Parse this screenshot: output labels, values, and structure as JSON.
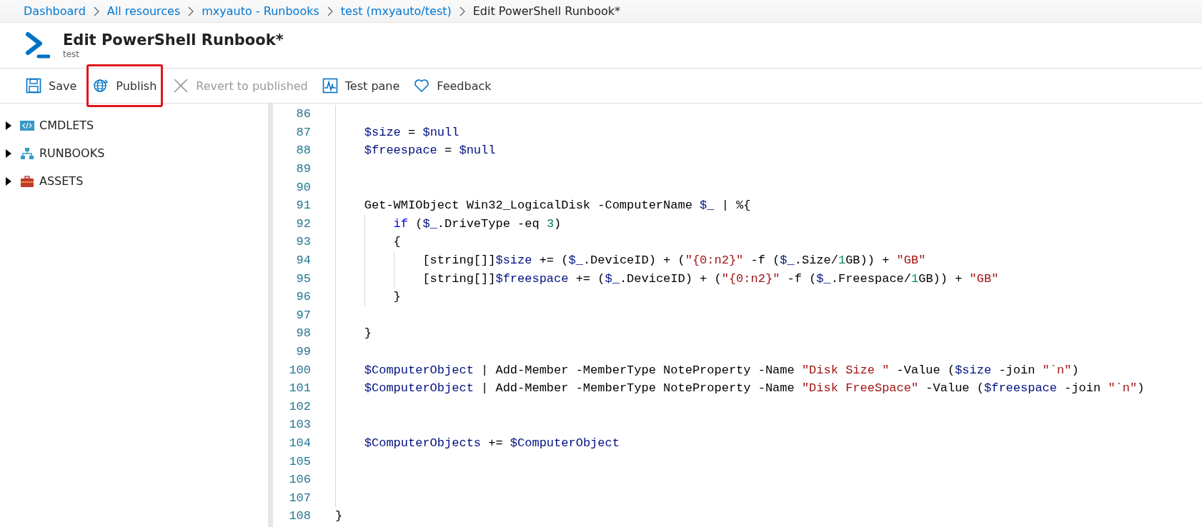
{
  "breadcrumb": [
    {
      "label": "Dashboard",
      "current": false
    },
    {
      "label": "All resources",
      "current": false
    },
    {
      "label": "mxyauto - Runbooks",
      "current": false
    },
    {
      "label": "test (mxyauto/test)",
      "current": false
    },
    {
      "label": "Edit PowerShell Runbook*",
      "current": true
    }
  ],
  "header": {
    "title": "Edit PowerShell Runbook*",
    "subtitle": "test"
  },
  "toolbar": [
    {
      "kind": "save",
      "label": "Save",
      "disabled": false,
      "highlighted": false
    },
    {
      "kind": "publish",
      "label": "Publish",
      "disabled": false,
      "highlighted": true
    },
    {
      "kind": "revert",
      "label": "Revert to published",
      "disabled": true,
      "highlighted": false
    },
    {
      "kind": "test",
      "label": "Test pane",
      "disabled": false,
      "highlighted": false
    },
    {
      "kind": "feedback",
      "label": "Feedback",
      "disabled": false,
      "highlighted": false
    }
  ],
  "sidebar": {
    "items": [
      {
        "kind": "cmdlets",
        "label": "CMDLETS",
        "expanded": false
      },
      {
        "kind": "runbooks",
        "label": "RUNBOOKS",
        "expanded": false
      },
      {
        "kind": "assets",
        "label": "ASSETS",
        "expanded": false
      }
    ]
  },
  "editor": {
    "lines": [
      {
        "number": "86"
      },
      {
        "number": "87",
        "tokens": [
          {
            "kind": "variable",
            "text": "    $size"
          },
          {
            "kind": "plain",
            "text": " = "
          },
          {
            "kind": "variable",
            "text": "$null"
          }
        ]
      },
      {
        "number": "88",
        "tokens": [
          {
            "kind": "variable",
            "text": "    $freespace"
          },
          {
            "kind": "plain",
            "text": " = "
          },
          {
            "kind": "variable",
            "text": "$null"
          }
        ]
      },
      {
        "number": "89"
      },
      {
        "number": "90"
      },
      {
        "number": "91",
        "tokens": [
          {
            "kind": "plain",
            "text": "    Get-WMIObject Win32_LogicalDisk -ComputerName "
          },
          {
            "kind": "variable",
            "text": "$_"
          },
          {
            "kind": "plain",
            "text": " | %{"
          }
        ]
      },
      {
        "number": "92",
        "tokens": [
          {
            "kind": "keyword",
            "text": "        if"
          },
          {
            "kind": "plain",
            "text": " ("
          },
          {
            "kind": "variable",
            "text": "$_"
          },
          {
            "kind": "plain",
            "text": ".DriveType -eq "
          },
          {
            "kind": "number",
            "text": "3"
          },
          {
            "kind": "plain",
            "text": ")"
          }
        ]
      },
      {
        "number": "93",
        "tokens": [
          {
            "kind": "plain",
            "text": "        {"
          }
        ]
      },
      {
        "number": "94",
        "tokens": [
          {
            "kind": "plain",
            "text": "            [string[]]"
          },
          {
            "kind": "variable",
            "text": "$size"
          },
          {
            "kind": "plain",
            "text": " += ("
          },
          {
            "kind": "variable",
            "text": "$_"
          },
          {
            "kind": "plain",
            "text": ".DeviceID) + ("
          },
          {
            "kind": "string",
            "text": "\"{0:n2}\""
          },
          {
            "kind": "plain",
            "text": " -f ("
          },
          {
            "kind": "variable",
            "text": "$_"
          },
          {
            "kind": "plain",
            "text": ".Size/"
          },
          {
            "kind": "number",
            "text": "1"
          },
          {
            "kind": "plain",
            "text": "GB)) + "
          },
          {
            "kind": "string",
            "text": "\"GB\""
          }
        ]
      },
      {
        "number": "95",
        "tokens": [
          {
            "kind": "plain",
            "text": "            [string[]]"
          },
          {
            "kind": "variable",
            "text": "$freespace"
          },
          {
            "kind": "plain",
            "text": " += ("
          },
          {
            "kind": "variable",
            "text": "$_"
          },
          {
            "kind": "plain",
            "text": ".DeviceID) + ("
          },
          {
            "kind": "string",
            "text": "\"{0:n2}\""
          },
          {
            "kind": "plain",
            "text": " -f ("
          },
          {
            "kind": "variable",
            "text": "$_"
          },
          {
            "kind": "plain",
            "text": ".Freespace/"
          },
          {
            "kind": "number",
            "text": "1"
          },
          {
            "kind": "plain",
            "text": "GB)) + "
          },
          {
            "kind": "string",
            "text": "\"GB\""
          }
        ]
      },
      {
        "number": "96",
        "tokens": [
          {
            "kind": "plain",
            "text": "        }"
          }
        ]
      },
      {
        "number": "97"
      },
      {
        "number": "98",
        "tokens": [
          {
            "kind": "plain",
            "text": "    }"
          }
        ]
      },
      {
        "number": "99"
      },
      {
        "number": "100",
        "tokens": [
          {
            "kind": "variable",
            "text": "    $ComputerObject"
          },
          {
            "kind": "plain",
            "text": " | Add-Member -MemberType NoteProperty -Name "
          },
          {
            "kind": "string",
            "text": "\"Disk Size \""
          },
          {
            "kind": "plain",
            "text": " -Value ("
          },
          {
            "kind": "variable",
            "text": "$size"
          },
          {
            "kind": "plain",
            "text": " -join "
          },
          {
            "kind": "string",
            "text": "\"`n\""
          },
          {
            "kind": "plain",
            "text": ")"
          }
        ]
      },
      {
        "number": "101",
        "tokens": [
          {
            "kind": "variable",
            "text": "    $ComputerObject"
          },
          {
            "kind": "plain",
            "text": " | Add-Member -MemberType NoteProperty -Name "
          },
          {
            "kind": "string",
            "text": "\"Disk FreeSpace\""
          },
          {
            "kind": "plain",
            "text": " -Value ("
          },
          {
            "kind": "variable",
            "text": "$freespace"
          },
          {
            "kind": "plain",
            "text": " -join "
          },
          {
            "kind": "string",
            "text": "\"`n\""
          },
          {
            "kind": "plain",
            "text": ")"
          }
        ]
      },
      {
        "number": "102"
      },
      {
        "number": "103"
      },
      {
        "number": "104",
        "tokens": [
          {
            "kind": "variable",
            "text": "    $ComputerObjects"
          },
          {
            "kind": "plain",
            "text": " += "
          },
          {
            "kind": "variable",
            "text": "$ComputerObject"
          }
        ]
      },
      {
        "number": "105"
      },
      {
        "number": "106"
      },
      {
        "number": "107"
      },
      {
        "number": "108",
        "tokens": [
          {
            "kind": "plain",
            "text": "}"
          }
        ]
      }
    ]
  }
}
